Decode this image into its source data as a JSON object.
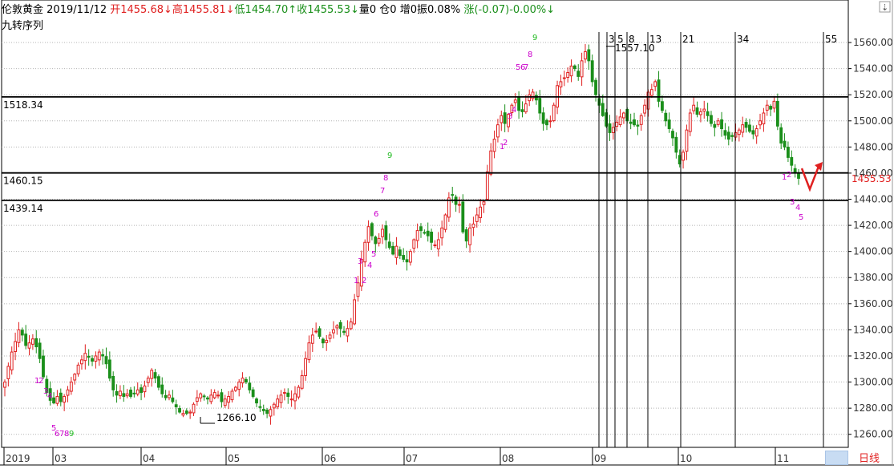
{
  "header": {
    "symbol": "伦敦黄金",
    "date": "2019/11/12",
    "open": "开1455.68↓",
    "high": "高1455.81↓",
    "low": "低1454.70↑",
    "close": "收1455.53↓",
    "volume": "量0",
    "position": "仓0",
    "increase": "增0",
    "amplitude": "振0.08%",
    "change": "涨(-0.07)-0.00%↓"
  },
  "indicator_label": "九转序列",
  "period_tab": "日线",
  "colors": {
    "up": "#e02020",
    "down": "#1a8f1a",
    "td": "#cc00cc",
    "td9": "#22bb22",
    "line": "#000000",
    "grid": "#b4b4b4"
  },
  "chart_data": {
    "type": "candlestick",
    "ylim": [
      1250,
      1568
    ],
    "y_ticks": [
      "1260.00",
      "1280.00",
      "1300.00",
      "1320.00",
      "1340.00",
      "1360.00",
      "1380.00",
      "1400.00",
      "1420.00",
      "1440.00",
      "1460.00",
      "1480.00",
      "1500.00",
      "1520.00",
      "1540.00",
      "1560.00"
    ],
    "x_labels": [
      "2019",
      "03",
      "04",
      "05",
      "06",
      "07",
      "08",
      "09",
      "10",
      "11"
    ],
    "current_price": "1455.53",
    "horizontal_lines": [
      {
        "label": "1518.34",
        "value": 1518.34
      },
      {
        "label": "1460.15",
        "value": 1460.15
      },
      {
        "label": "1439.14",
        "value": 1439.14
      }
    ],
    "fib_lines": [
      "3",
      "5",
      "8",
      "13",
      "21",
      "34",
      "55"
    ],
    "price_labels": [
      {
        "text": "1557.10",
        "value": 1557.1
      },
      {
        "text": "1266.10",
        "value": 1266.1
      }
    ],
    "td_sequences": [
      [
        "1",
        "2",
        "3",
        "4",
        "5",
        "6",
        "7",
        "8",
        "9"
      ],
      [
        "1",
        "2",
        "3",
        "4",
        "5",
        "6",
        "7",
        "8",
        "9"
      ],
      [
        "1",
        "2",
        "3",
        "4",
        "5",
        "6",
        "7",
        "8",
        "9"
      ],
      [
        "1",
        "2",
        "3",
        "4",
        "5"
      ]
    ],
    "closes": [
      1300,
      1312,
      1323,
      1331,
      1340,
      1336,
      1328,
      1330,
      1333,
      1327,
      1318,
      1304,
      1292,
      1286,
      1284,
      1289,
      1285,
      1289,
      1294,
      1300,
      1306,
      1313,
      1317,
      1322,
      1319,
      1316,
      1320,
      1323,
      1320,
      1314,
      1303,
      1294,
      1290,
      1293,
      1289,
      1291,
      1289,
      1291,
      1294,
      1292,
      1297,
      1303,
      1309,
      1303,
      1296,
      1291,
      1288,
      1290,
      1285,
      1281,
      1277,
      1276,
      1276,
      1277,
      1283,
      1288,
      1291,
      1289,
      1287,
      1290,
      1292,
      1290,
      1285,
      1287,
      1289,
      1293,
      1296,
      1300,
      1303,
      1300,
      1294,
      1289,
      1284,
      1281,
      1278,
      1276,
      1279,
      1283,
      1287,
      1290,
      1292,
      1289,
      1287,
      1291,
      1296,
      1305,
      1318,
      1330,
      1336,
      1339,
      1335,
      1330,
      1332,
      1336,
      1340,
      1343,
      1341,
      1338,
      1341,
      1346,
      1363,
      1376,
      1394,
      1407,
      1419,
      1412,
      1406,
      1410,
      1417,
      1409,
      1403,
      1398,
      1404,
      1397,
      1394,
      1392,
      1400,
      1409,
      1416,
      1416,
      1414,
      1412,
      1407,
      1405,
      1409,
      1418,
      1428,
      1441,
      1443,
      1436,
      1436,
      1415,
      1408,
      1418,
      1421,
      1428,
      1434,
      1438,
      1461,
      1477,
      1486,
      1497,
      1504,
      1498,
      1505,
      1512,
      1516,
      1508,
      1507,
      1513,
      1520,
      1522,
      1516,
      1506,
      1498,
      1497,
      1500,
      1512,
      1527,
      1530,
      1533,
      1537,
      1542,
      1540,
      1534,
      1546,
      1553,
      1546,
      1530,
      1520,
      1512,
      1504,
      1496,
      1491,
      1495,
      1499,
      1503,
      1506,
      1500,
      1498,
      1497,
      1496,
      1504,
      1512,
      1522,
      1524,
      1530,
      1515,
      1508,
      1500,
      1494,
      1487,
      1476,
      1467,
      1476,
      1493,
      1506,
      1512,
      1505,
      1507,
      1509,
      1504,
      1498,
      1495,
      1500,
      1494,
      1489,
      1486,
      1488,
      1491,
      1493,
      1497,
      1495,
      1492,
      1490,
      1494,
      1500,
      1506,
      1512,
      1509,
      1515,
      1496,
      1483,
      1480,
      1472,
      1466,
      1460,
      1456
    ]
  }
}
